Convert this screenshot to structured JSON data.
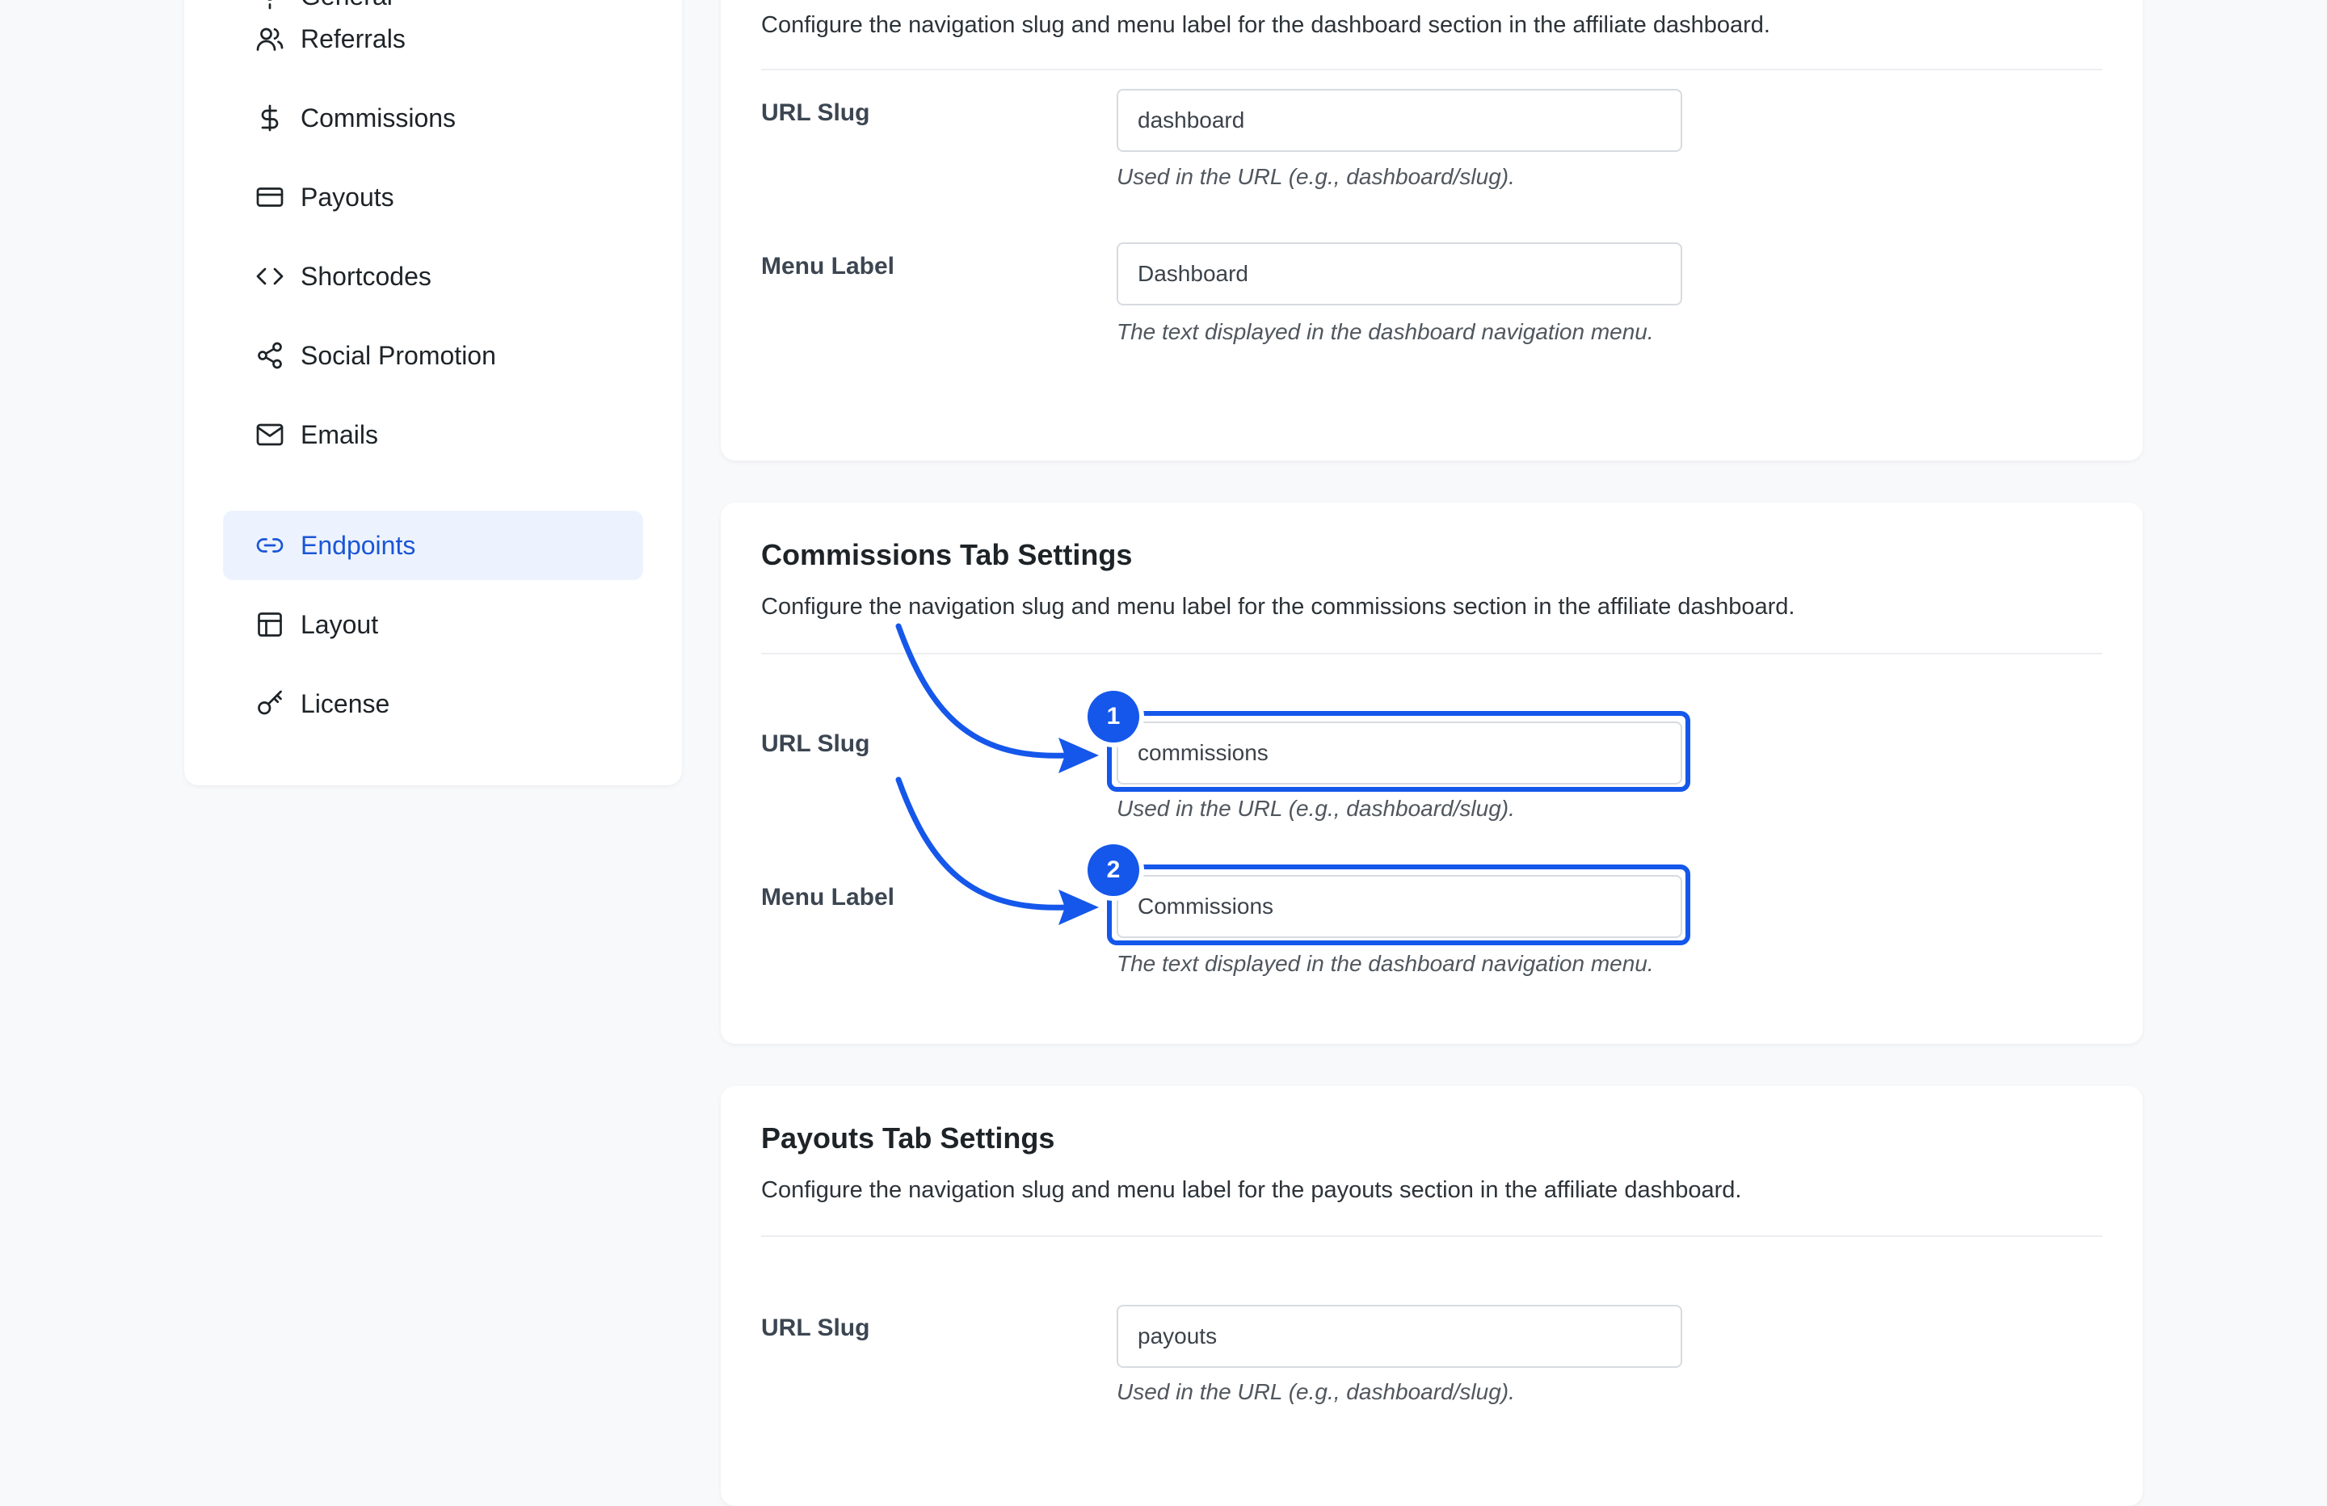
{
  "sidebar": {
    "items": [
      {
        "label": "General",
        "icon": "general-icon"
      },
      {
        "label": "Referrals",
        "icon": "users-icon"
      },
      {
        "label": "Commissions",
        "icon": "dollar-icon"
      },
      {
        "label": "Payouts",
        "icon": "credit-card-icon"
      },
      {
        "label": "Shortcodes",
        "icon": "code-icon"
      },
      {
        "label": "Social Promotion",
        "icon": "share-icon"
      },
      {
        "label": "Emails",
        "icon": "mail-icon"
      },
      {
        "label": "Endpoints",
        "icon": "link-icon",
        "active": true
      },
      {
        "label": "Layout",
        "icon": "layout-icon"
      },
      {
        "label": "License",
        "icon": "key-icon"
      }
    ],
    "active_color": "#1a56d6",
    "active_bg": "#edf3fe"
  },
  "dashboard_section": {
    "description": "Configure the navigation slug and menu label for the dashboard section in the affiliate dashboard.",
    "url_slug_label": "URL Slug",
    "url_slug_value": "dashboard",
    "url_slug_help": "Used in the URL (e.g., dashboard/slug).",
    "menu_label_label": "Menu Label",
    "menu_label_value": "Dashboard",
    "menu_label_help": "The text displayed in the dashboard navigation menu."
  },
  "commissions_section": {
    "title": "Commissions Tab Settings",
    "description": "Configure the navigation slug and menu label for the commissions section in the affiliate dashboard.",
    "url_slug_label": "URL Slug",
    "url_slug_value": "commissions",
    "url_slug_help": "Used in the URL (e.g., dashboard/slug).",
    "menu_label_label": "Menu Label",
    "menu_label_value": "Commissions",
    "menu_label_help": "The text displayed in the dashboard navigation menu."
  },
  "payouts_section": {
    "title": "Payouts Tab Settings",
    "description": "Configure the navigation slug and menu label for the payouts section in the affiliate dashboard.",
    "url_slug_label": "URL Slug",
    "url_slug_value": "payouts",
    "url_slug_help": "Used in the URL (e.g., dashboard/slug)."
  },
  "annotations": {
    "badge_1": "1",
    "badge_2": "2",
    "color": "#1557ea"
  }
}
